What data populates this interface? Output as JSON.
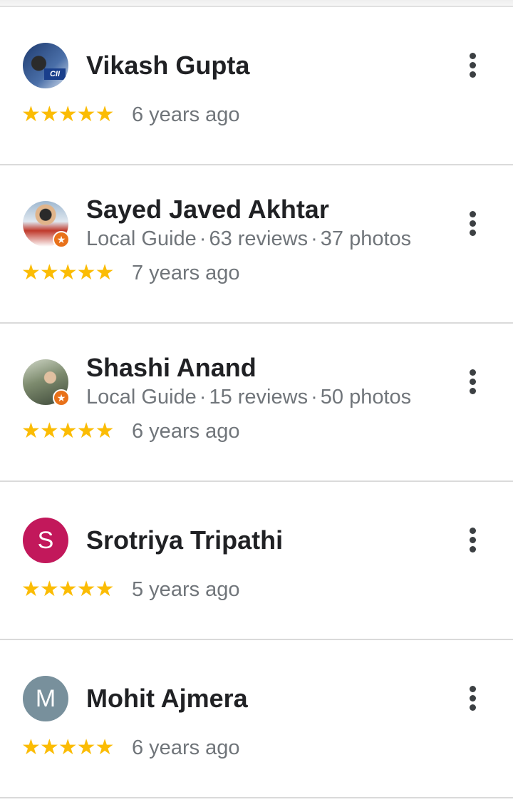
{
  "reviews": [
    {
      "name": "Vikash Gupta",
      "meta": null,
      "stars": "★★★★★",
      "rating": 5,
      "when": "6 years ago",
      "avatar": {
        "type": "photo",
        "colors": [
          "#1e3a6e",
          "#4a6fa8"
        ]
      }
    },
    {
      "name": "Sayed Javed Akhtar",
      "meta": {
        "badge": "Local Guide",
        "reviews": "63 reviews",
        "photos": "37 photos"
      },
      "stars": "★★★★★",
      "rating": 5,
      "when": "7 years ago",
      "avatar": {
        "type": "photo",
        "colors": [
          "#9fb8d0",
          "#c0392b"
        ]
      }
    },
    {
      "name": "Shashi Anand",
      "meta": {
        "badge": "Local Guide",
        "reviews": "15 reviews",
        "photos": "50 photos"
      },
      "stars": "★★★★★",
      "rating": 5,
      "when": "6 years ago",
      "avatar": {
        "type": "photo",
        "colors": [
          "#7d8b6e",
          "#3f4a3a"
        ]
      }
    },
    {
      "name": "Srotriya Tripathi",
      "meta": null,
      "stars": "★★★★★",
      "rating": 5,
      "when": "5 years ago",
      "avatar": {
        "type": "letter",
        "letter": "S",
        "color": "#c2185b"
      }
    },
    {
      "name": "Mohit Ajmera",
      "meta": null,
      "stars": "★★★★★",
      "rating": 5,
      "when": "6 years ago",
      "avatar": {
        "type": "letter",
        "letter": "M",
        "color": "#78909c"
      }
    }
  ],
  "colors": {
    "star": "#fbbc04",
    "name": "#202124",
    "secondary": "#70757a",
    "local_guide_badge": "#e8711a"
  }
}
